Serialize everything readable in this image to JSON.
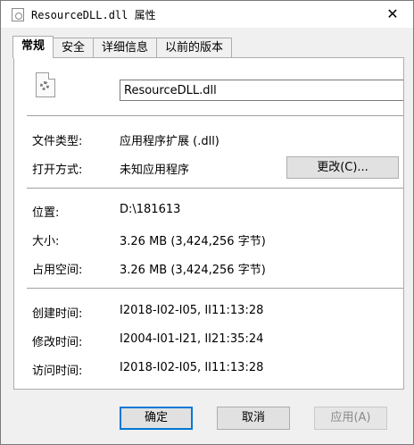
{
  "window": {
    "title": "ResourceDLL.dll 属性",
    "close_glyph": "✕"
  },
  "tabs": [
    {
      "label": "常规",
      "active": true
    },
    {
      "label": "安全",
      "active": false
    },
    {
      "label": "详细信息",
      "active": false
    },
    {
      "label": "以前的版本",
      "active": false
    }
  ],
  "general": {
    "file_name": "ResourceDLL.dll",
    "file_type": {
      "label": "文件类型:",
      "value": "应用程序扩展 (.dll)"
    },
    "open_with": {
      "label": "打开方式:",
      "value": "未知应用程序",
      "button": "更改(C)..."
    },
    "location": {
      "label": "位置:",
      "value": "D:\\181613"
    },
    "size": {
      "label": "大小:",
      "value": "3.26 MB (3,424,256 字节)"
    },
    "size_on_disk": {
      "label": "占用空间:",
      "value": "3.26 MB (3,424,256 字节)"
    },
    "created": {
      "label": "创建时间:",
      "value": "I2018-I02-I05, II11:13:28"
    },
    "modified": {
      "label": "修改时间:",
      "value": "I2004-I01-I21, II21:35:24"
    },
    "accessed": {
      "label": "访问时间:",
      "value": "I2018-I02-I05, II11:13:28"
    }
  },
  "buttons": {
    "ok": "确定",
    "cancel": "取消",
    "apply": "应用(A)"
  },
  "icons": {
    "title_icon": "dll-file-icon",
    "file_icon": "dll-gear-file-icon"
  },
  "colors": {
    "accent": "#0078d7",
    "panel": "#ffffff",
    "chrome": "#f0f0f0"
  }
}
